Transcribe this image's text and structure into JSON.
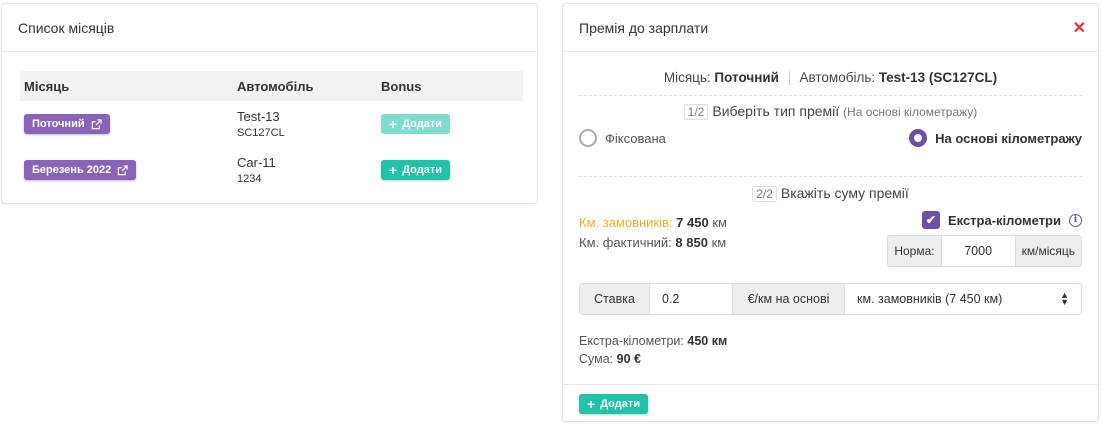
{
  "months_card": {
    "title": "Список місяців",
    "columns": [
      "Місяць",
      "Автомобіль",
      "Bonus"
    ],
    "rows": [
      {
        "month": "Поточний",
        "car_name": "Test-13",
        "car_plate": "SC127CL",
        "bonus_label": "Додати",
        "bonus_enabled": false
      },
      {
        "month": "Березень 2022",
        "car_name": "Car-11",
        "car_plate": "1234",
        "bonus_label": "Додати",
        "bonus_enabled": true
      }
    ]
  },
  "bonus_card": {
    "title": "Премія до зарплати",
    "month_label": "Місяць:",
    "month_value": "Поточний",
    "car_label": "Автомобіль:",
    "car_value": "Test-13 (SC127CL)",
    "step1": {
      "num": "1/2",
      "label": "Виберіть тип премії",
      "hint": "(На основі кілометражу)"
    },
    "radio_fixed": "Фіксована",
    "radio_mileage": "На основі кілометражу",
    "step2": {
      "num": "2/2",
      "label": "Вкажіть суму премії"
    },
    "km_customers_label": "Км. замовників:",
    "km_customers_value": "7 450",
    "km_unit": "км",
    "km_actual_label": "Км. фактичний:",
    "km_actual_value": "8 850",
    "extra_km_label": "Екстра-кілометри",
    "extra_km_checked": true,
    "norm_label": "Норма:",
    "norm_value": "7000",
    "norm_unit": "км/місяць",
    "rate_label": "Ставка",
    "rate_value": "0.2",
    "rate_unit": "€/км на основі",
    "rate_basis": "км. замовників (7 450 км)",
    "extra_km_summary_label": "Екстра-кілометри:",
    "extra_km_summary_value": "450 км",
    "sum_label": "Сума:",
    "sum_value": "90 €",
    "add_label": "Додати"
  },
  "colors": {
    "purple_badge": "#8a63b8",
    "purple_accent": "#6f4ea8",
    "teal_button": "#20c2a8",
    "highlight_orange": "#f0ad2a",
    "close_red": "#dd3333"
  }
}
